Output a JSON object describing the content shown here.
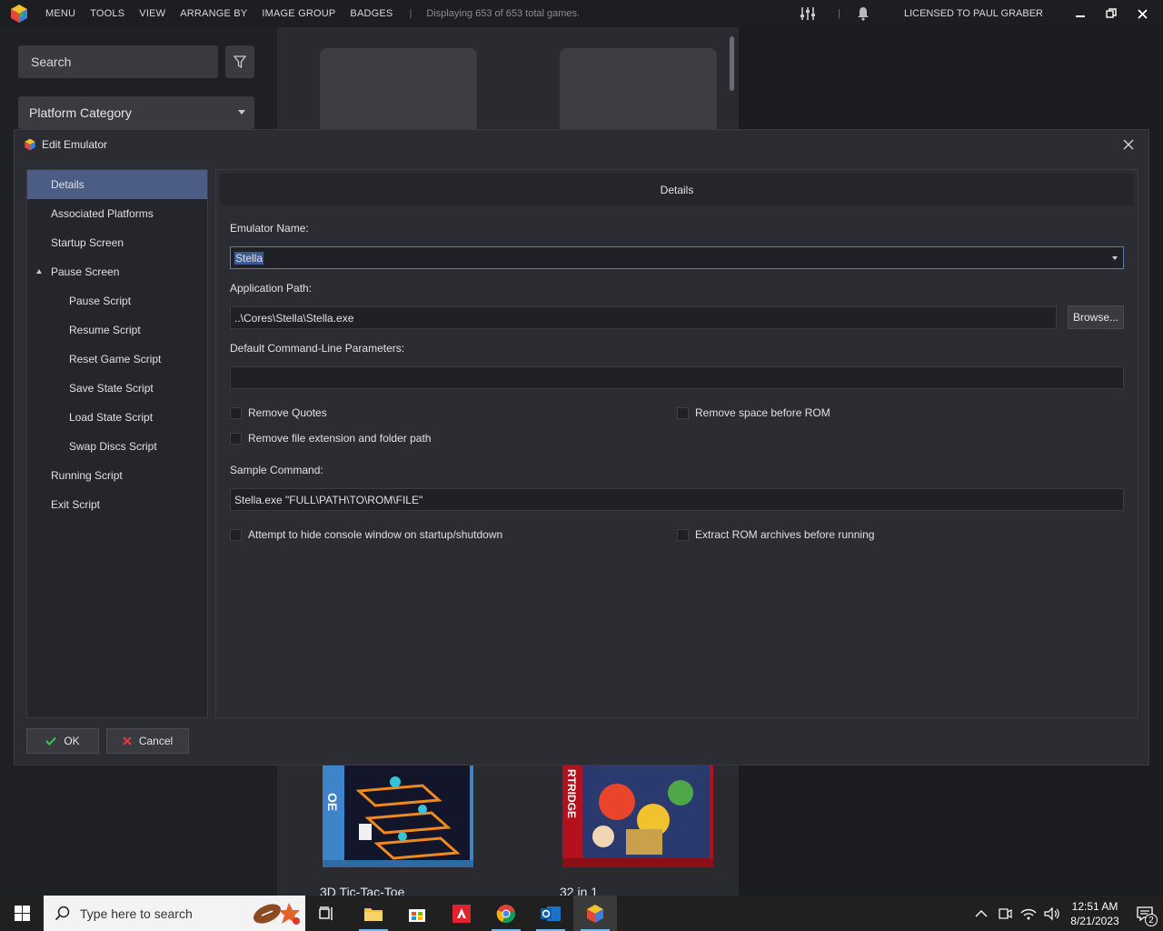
{
  "topbar": {
    "menus": [
      "MENU",
      "TOOLS",
      "VIEW",
      "ARRANGE BY",
      "IMAGE GROUP",
      "BADGES"
    ],
    "separator": "|",
    "status": "Displaying 653 of 653 total games.",
    "license": "LICENSED TO PAUL GRABER"
  },
  "sidebar": {
    "search_placeholder": "Search",
    "filter_label": "Platform Category"
  },
  "games": [
    {
      "title": "3D Tic-Tac-Toe"
    },
    {
      "title": "32 in 1"
    }
  ],
  "dialog": {
    "title": "Edit Emulator",
    "tree": [
      {
        "label": "Details",
        "level": 0,
        "selected": true
      },
      {
        "label": "Associated Platforms",
        "level": 0
      },
      {
        "label": "Startup Screen",
        "level": 0
      },
      {
        "label": "Pause Screen",
        "level": 0,
        "expanded": true
      },
      {
        "label": "Pause Script",
        "level": 1
      },
      {
        "label": "Resume Script",
        "level": 1
      },
      {
        "label": "Reset Game Script",
        "level": 1
      },
      {
        "label": "Save State Script",
        "level": 1
      },
      {
        "label": "Load State Script",
        "level": 1
      },
      {
        "label": "Swap Discs Script",
        "level": 1
      },
      {
        "label": "Running Script",
        "level": 0
      },
      {
        "label": "Exit Script",
        "level": 0
      }
    ],
    "header": "Details",
    "emulator_name_label": "Emulator Name:",
    "emulator_name_value": "Stella",
    "app_path_label": "Application Path:",
    "app_path_value": "..\\Cores\\Stella\\Stella.exe",
    "browse_label": "Browse...",
    "params_label": "Default Command-Line Parameters:",
    "params_value": "",
    "remove_quotes": {
      "label": "Remove Quotes",
      "checked": false
    },
    "remove_space": {
      "label": "Remove space before ROM",
      "checked": false
    },
    "remove_ext": {
      "label": "Remove file extension and folder path",
      "checked": false
    },
    "sample_label": "Sample Command:",
    "sample_value": "Stella.exe \"FULL\\PATH\\TO\\ROM\\FILE\"",
    "hide_console": {
      "label": "Attempt to hide console window on startup/shutdown",
      "checked": false
    },
    "extract_rom": {
      "label": "Extract ROM archives before running",
      "checked": false
    },
    "ok_label": "OK",
    "cancel_label": "Cancel"
  },
  "taskbar": {
    "search_placeholder": "Type here to search",
    "time": "12:51 AM",
    "date": "8/21/2023",
    "notification_count": "2"
  },
  "colors": {
    "accent": "#4b5d85",
    "ok_check": "#3cc25a",
    "cancel_x": "#e03a3a"
  }
}
